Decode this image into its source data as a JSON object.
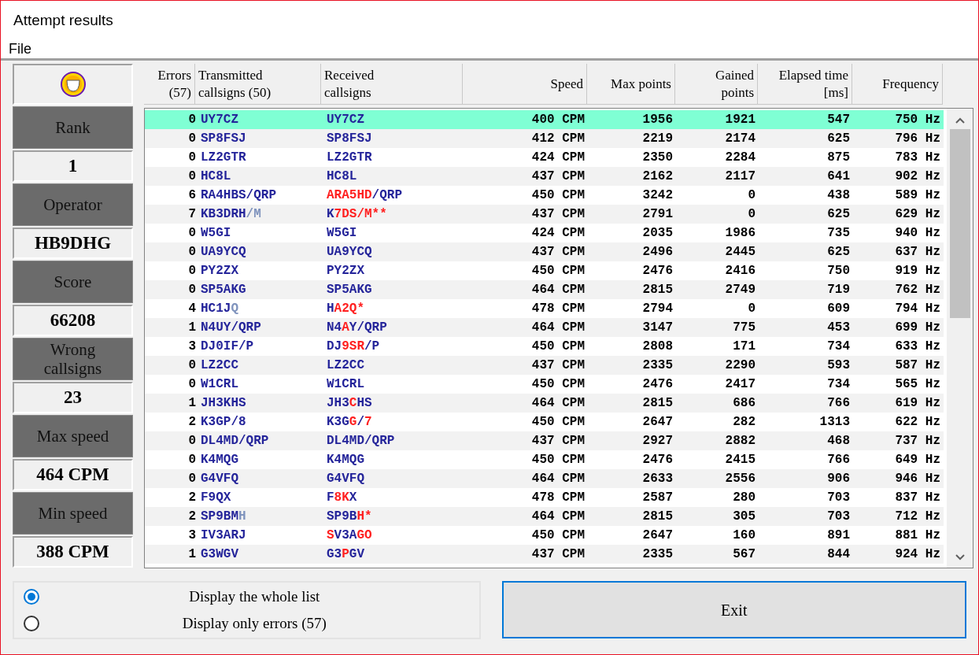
{
  "window": {
    "title": "Attempt results"
  },
  "menu": [
    "File"
  ],
  "summary": [
    {
      "label": [
        "Rank"
      ],
      "value": "1"
    },
    {
      "label": [
        "Operator"
      ],
      "value": "HB9DHG"
    },
    {
      "label": [
        "Score"
      ],
      "value": "66208"
    },
    {
      "label": [
        "Wrong",
        "callsigns"
      ],
      "value": "23"
    },
    {
      "label": [
        "Max speed"
      ],
      "value": "464 CPM"
    },
    {
      "label": [
        "Min speed"
      ],
      "value": "388 CPM"
    }
  ],
  "table": {
    "columns": [
      [
        "Errors",
        "(57)"
      ],
      [
        "Transmitted",
        "callsigns (50)"
      ],
      [
        "Received",
        "callsigns"
      ],
      [
        "Speed"
      ],
      [
        "Max points"
      ],
      [
        "Gained",
        "points"
      ],
      [
        "Elapsed time",
        "[ms]"
      ],
      [
        "Frequency"
      ]
    ],
    "rows": [
      {
        "selected": true,
        "errors": "0",
        "sent": [
          {
            "kind": "ok",
            "text": "UY7CZ"
          }
        ],
        "received": [
          {
            "kind": "ok",
            "text": "UY7CZ"
          }
        ],
        "speed": "400 CPM",
        "max": "1956",
        "gained": "1921",
        "elapsed": "547",
        "freq": "750 Hz"
      },
      {
        "selected": false,
        "errors": "0",
        "sent": [
          {
            "kind": "ok",
            "text": "SP8FSJ"
          }
        ],
        "received": [
          {
            "kind": "ok",
            "text": "SP8FSJ"
          }
        ],
        "speed": "412 CPM",
        "max": "2219",
        "gained": "2174",
        "elapsed": "625",
        "freq": "796 Hz"
      },
      {
        "selected": false,
        "errors": "0",
        "sent": [
          {
            "kind": "ok",
            "text": "LZ2GTR"
          }
        ],
        "received": [
          {
            "kind": "ok",
            "text": "LZ2GTR"
          }
        ],
        "speed": "424 CPM",
        "max": "2350",
        "gained": "2284",
        "elapsed": "875",
        "freq": "783 Hz"
      },
      {
        "selected": false,
        "errors": "0",
        "sent": [
          {
            "kind": "ok",
            "text": "HC8L"
          }
        ],
        "received": [
          {
            "kind": "ok",
            "text": "HC8L"
          }
        ],
        "speed": "437 CPM",
        "max": "2162",
        "gained": "2117",
        "elapsed": "641",
        "freq": "902 Hz"
      },
      {
        "selected": false,
        "errors": "6",
        "sent": [
          {
            "kind": "ok",
            "text": "RA4HBS/QRP"
          }
        ],
        "received": [
          {
            "kind": "error",
            "text": "ARA5HD"
          },
          {
            "kind": "ok",
            "text": "/QRP"
          }
        ],
        "speed": "450 CPM",
        "max": "3242",
        "gained": "0",
        "elapsed": "438",
        "freq": "589 Hz"
      },
      {
        "selected": false,
        "errors": "7",
        "sent": [
          {
            "kind": "ok",
            "text": "KB3DRH"
          },
          {
            "kind": "missing",
            "text": "/M"
          }
        ],
        "received": [
          {
            "kind": "ok",
            "text": "K"
          },
          {
            "kind": "error",
            "text": "7DS/M**"
          }
        ],
        "speed": "437 CPM",
        "max": "2791",
        "gained": "0",
        "elapsed": "625",
        "freq": "629 Hz"
      },
      {
        "selected": false,
        "errors": "0",
        "sent": [
          {
            "kind": "ok",
            "text": "W5GI"
          }
        ],
        "received": [
          {
            "kind": "ok",
            "text": "W5GI"
          }
        ],
        "speed": "424 CPM",
        "max": "2035",
        "gained": "1986",
        "elapsed": "735",
        "freq": "940 Hz"
      },
      {
        "selected": false,
        "errors": "0",
        "sent": [
          {
            "kind": "ok",
            "text": "UA9YCQ"
          }
        ],
        "received": [
          {
            "kind": "ok",
            "text": "UA9YCQ"
          }
        ],
        "speed": "437 CPM",
        "max": "2496",
        "gained": "2445",
        "elapsed": "625",
        "freq": "637 Hz"
      },
      {
        "selected": false,
        "errors": "0",
        "sent": [
          {
            "kind": "ok",
            "text": "PY2ZX"
          }
        ],
        "received": [
          {
            "kind": "ok",
            "text": "PY2ZX"
          }
        ],
        "speed": "450 CPM",
        "max": "2476",
        "gained": "2416",
        "elapsed": "750",
        "freq": "919 Hz"
      },
      {
        "selected": false,
        "errors": "0",
        "sent": [
          {
            "kind": "ok",
            "text": "SP5AKG"
          }
        ],
        "received": [
          {
            "kind": "ok",
            "text": "SP5AKG"
          }
        ],
        "speed": "464 CPM",
        "max": "2815",
        "gained": "2749",
        "elapsed": "719",
        "freq": "762 Hz"
      },
      {
        "selected": false,
        "errors": "4",
        "sent": [
          {
            "kind": "ok",
            "text": "HC1J"
          },
          {
            "kind": "missing",
            "text": "Q"
          }
        ],
        "received": [
          {
            "kind": "ok",
            "text": "H"
          },
          {
            "kind": "error",
            "text": "A2Q*"
          }
        ],
        "speed": "478 CPM",
        "max": "2794",
        "gained": "0",
        "elapsed": "609",
        "freq": "794 Hz"
      },
      {
        "selected": false,
        "errors": "1",
        "sent": [
          {
            "kind": "ok",
            "text": "N4UY/QRP"
          }
        ],
        "received": [
          {
            "kind": "ok",
            "text": "N4"
          },
          {
            "kind": "error",
            "text": "A"
          },
          {
            "kind": "ok",
            "text": "Y/QRP"
          }
        ],
        "speed": "464 CPM",
        "max": "3147",
        "gained": "775",
        "elapsed": "453",
        "freq": "699 Hz"
      },
      {
        "selected": false,
        "errors": "3",
        "sent": [
          {
            "kind": "ok",
            "text": "DJ0IF/P"
          }
        ],
        "received": [
          {
            "kind": "ok",
            "text": "DJ"
          },
          {
            "kind": "error",
            "text": "9SR"
          },
          {
            "kind": "ok",
            "text": "/P"
          }
        ],
        "speed": "450 CPM",
        "max": "2808",
        "gained": "171",
        "elapsed": "734",
        "freq": "633 Hz"
      },
      {
        "selected": false,
        "errors": "0",
        "sent": [
          {
            "kind": "ok",
            "text": "LZ2CC"
          }
        ],
        "received": [
          {
            "kind": "ok",
            "text": "LZ2CC"
          }
        ],
        "speed": "437 CPM",
        "max": "2335",
        "gained": "2290",
        "elapsed": "593",
        "freq": "587 Hz"
      },
      {
        "selected": false,
        "errors": "0",
        "sent": [
          {
            "kind": "ok",
            "text": "W1CRL"
          }
        ],
        "received": [
          {
            "kind": "ok",
            "text": "W1CRL"
          }
        ],
        "speed": "450 CPM",
        "max": "2476",
        "gained": "2417",
        "elapsed": "734",
        "freq": "565 Hz"
      },
      {
        "selected": false,
        "errors": "1",
        "sent": [
          {
            "kind": "ok",
            "text": "JH3KHS"
          }
        ],
        "received": [
          {
            "kind": "ok",
            "text": "JH3"
          },
          {
            "kind": "error",
            "text": "C"
          },
          {
            "kind": "ok",
            "text": "HS"
          }
        ],
        "speed": "464 CPM",
        "max": "2815",
        "gained": "686",
        "elapsed": "766",
        "freq": "619 Hz"
      },
      {
        "selected": false,
        "errors": "2",
        "sent": [
          {
            "kind": "ok",
            "text": "K3GP/8"
          }
        ],
        "received": [
          {
            "kind": "ok",
            "text": "K3G"
          },
          {
            "kind": "error",
            "text": "G"
          },
          {
            "kind": "ok",
            "text": "/"
          },
          {
            "kind": "error",
            "text": "7"
          }
        ],
        "speed": "450 CPM",
        "max": "2647",
        "gained": "282",
        "elapsed": "1313",
        "freq": "622 Hz"
      },
      {
        "selected": false,
        "errors": "0",
        "sent": [
          {
            "kind": "ok",
            "text": "DL4MD/QRP"
          }
        ],
        "received": [
          {
            "kind": "ok",
            "text": "DL4MD/QRP"
          }
        ],
        "speed": "437 CPM",
        "max": "2927",
        "gained": "2882",
        "elapsed": "468",
        "freq": "737 Hz"
      },
      {
        "selected": false,
        "errors": "0",
        "sent": [
          {
            "kind": "ok",
            "text": "K4MQG"
          }
        ],
        "received": [
          {
            "kind": "ok",
            "text": "K4MQG"
          }
        ],
        "speed": "450 CPM",
        "max": "2476",
        "gained": "2415",
        "elapsed": "766",
        "freq": "649 Hz"
      },
      {
        "selected": false,
        "errors": "0",
        "sent": [
          {
            "kind": "ok",
            "text": "G4VFQ"
          }
        ],
        "received": [
          {
            "kind": "ok",
            "text": "G4VFQ"
          }
        ],
        "speed": "464 CPM",
        "max": "2633",
        "gained": "2556",
        "elapsed": "906",
        "freq": "946 Hz"
      },
      {
        "selected": false,
        "errors": "2",
        "sent": [
          {
            "kind": "ok",
            "text": "F9QX"
          }
        ],
        "received": [
          {
            "kind": "ok",
            "text": "F"
          },
          {
            "kind": "error",
            "text": "8K"
          },
          {
            "kind": "ok",
            "text": "X"
          }
        ],
        "speed": "478 CPM",
        "max": "2587",
        "gained": "280",
        "elapsed": "703",
        "freq": "837 Hz"
      },
      {
        "selected": false,
        "errors": "2",
        "sent": [
          {
            "kind": "ok",
            "text": "SP9BM"
          },
          {
            "kind": "missing",
            "text": "H"
          }
        ],
        "received": [
          {
            "kind": "ok",
            "text": "SP9B"
          },
          {
            "kind": "error",
            "text": "H*"
          }
        ],
        "speed": "464 CPM",
        "max": "2815",
        "gained": "305",
        "elapsed": "703",
        "freq": "712 Hz"
      },
      {
        "selected": false,
        "errors": "3",
        "sent": [
          {
            "kind": "ok",
            "text": "IV3ARJ"
          }
        ],
        "received": [
          {
            "kind": "error",
            "text": "S"
          },
          {
            "kind": "ok",
            "text": "V3A"
          },
          {
            "kind": "error",
            "text": "GO"
          }
        ],
        "speed": "450 CPM",
        "max": "2647",
        "gained": "160",
        "elapsed": "891",
        "freq": "881 Hz"
      },
      {
        "selected": false,
        "errors": "1",
        "sent": [
          {
            "kind": "ok",
            "text": "G3WGV"
          }
        ],
        "received": [
          {
            "kind": "ok",
            "text": "G3"
          },
          {
            "kind": "error",
            "text": "P"
          },
          {
            "kind": "ok",
            "text": "GV"
          }
        ],
        "speed": "437 CPM",
        "max": "2335",
        "gained": "567",
        "elapsed": "844",
        "freq": "924 Hz"
      }
    ]
  },
  "filter": [
    {
      "label": "Display the whole list",
      "selected": true
    },
    {
      "label": "Display only errors (57)",
      "selected": false
    }
  ],
  "exit_button": "Exit"
}
